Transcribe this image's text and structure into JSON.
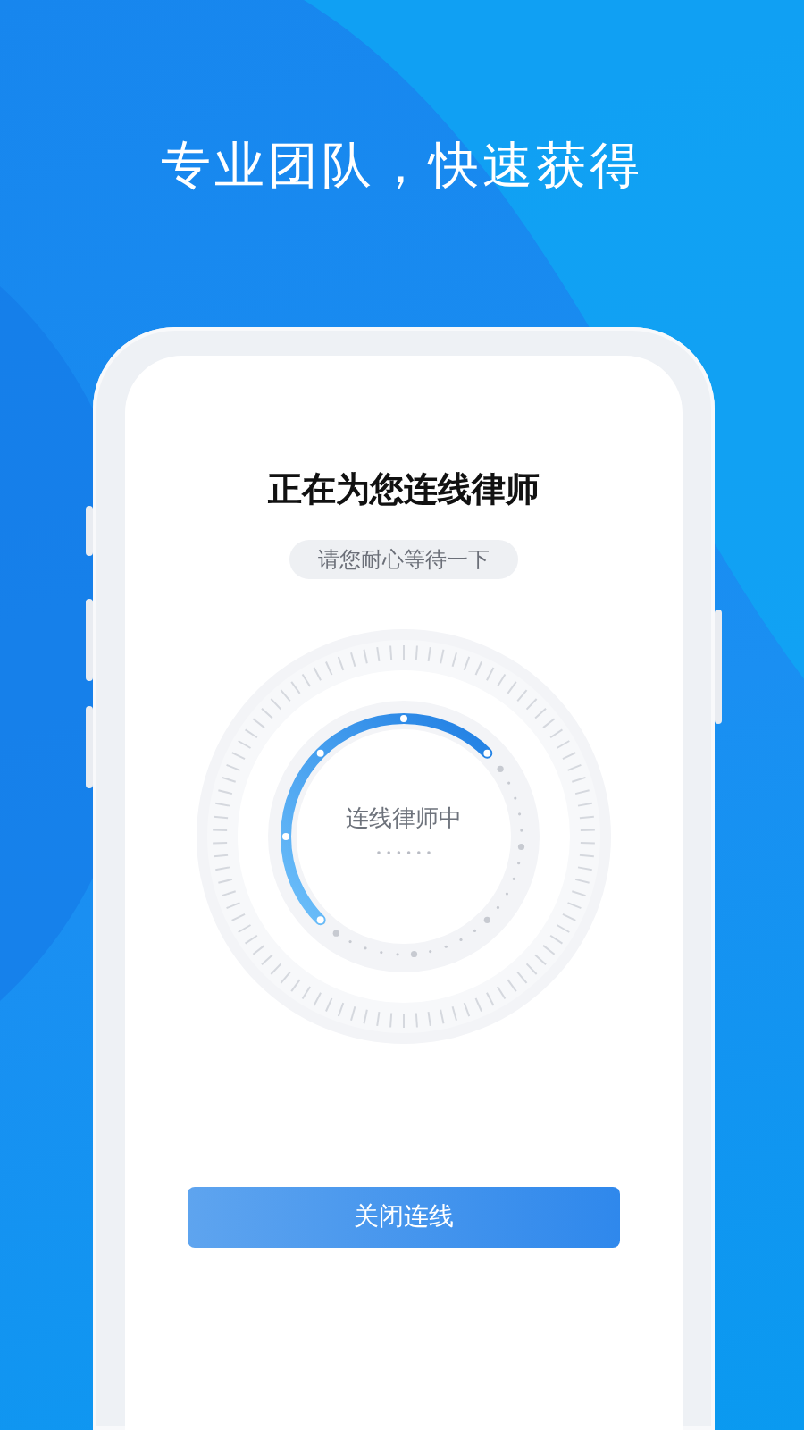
{
  "headline": "专业团队，快速获得",
  "screen": {
    "title": "正在为您连线律师",
    "subtitle": "请您耐心等待一下",
    "status": "连线律师中",
    "button": "关闭连线"
  }
}
